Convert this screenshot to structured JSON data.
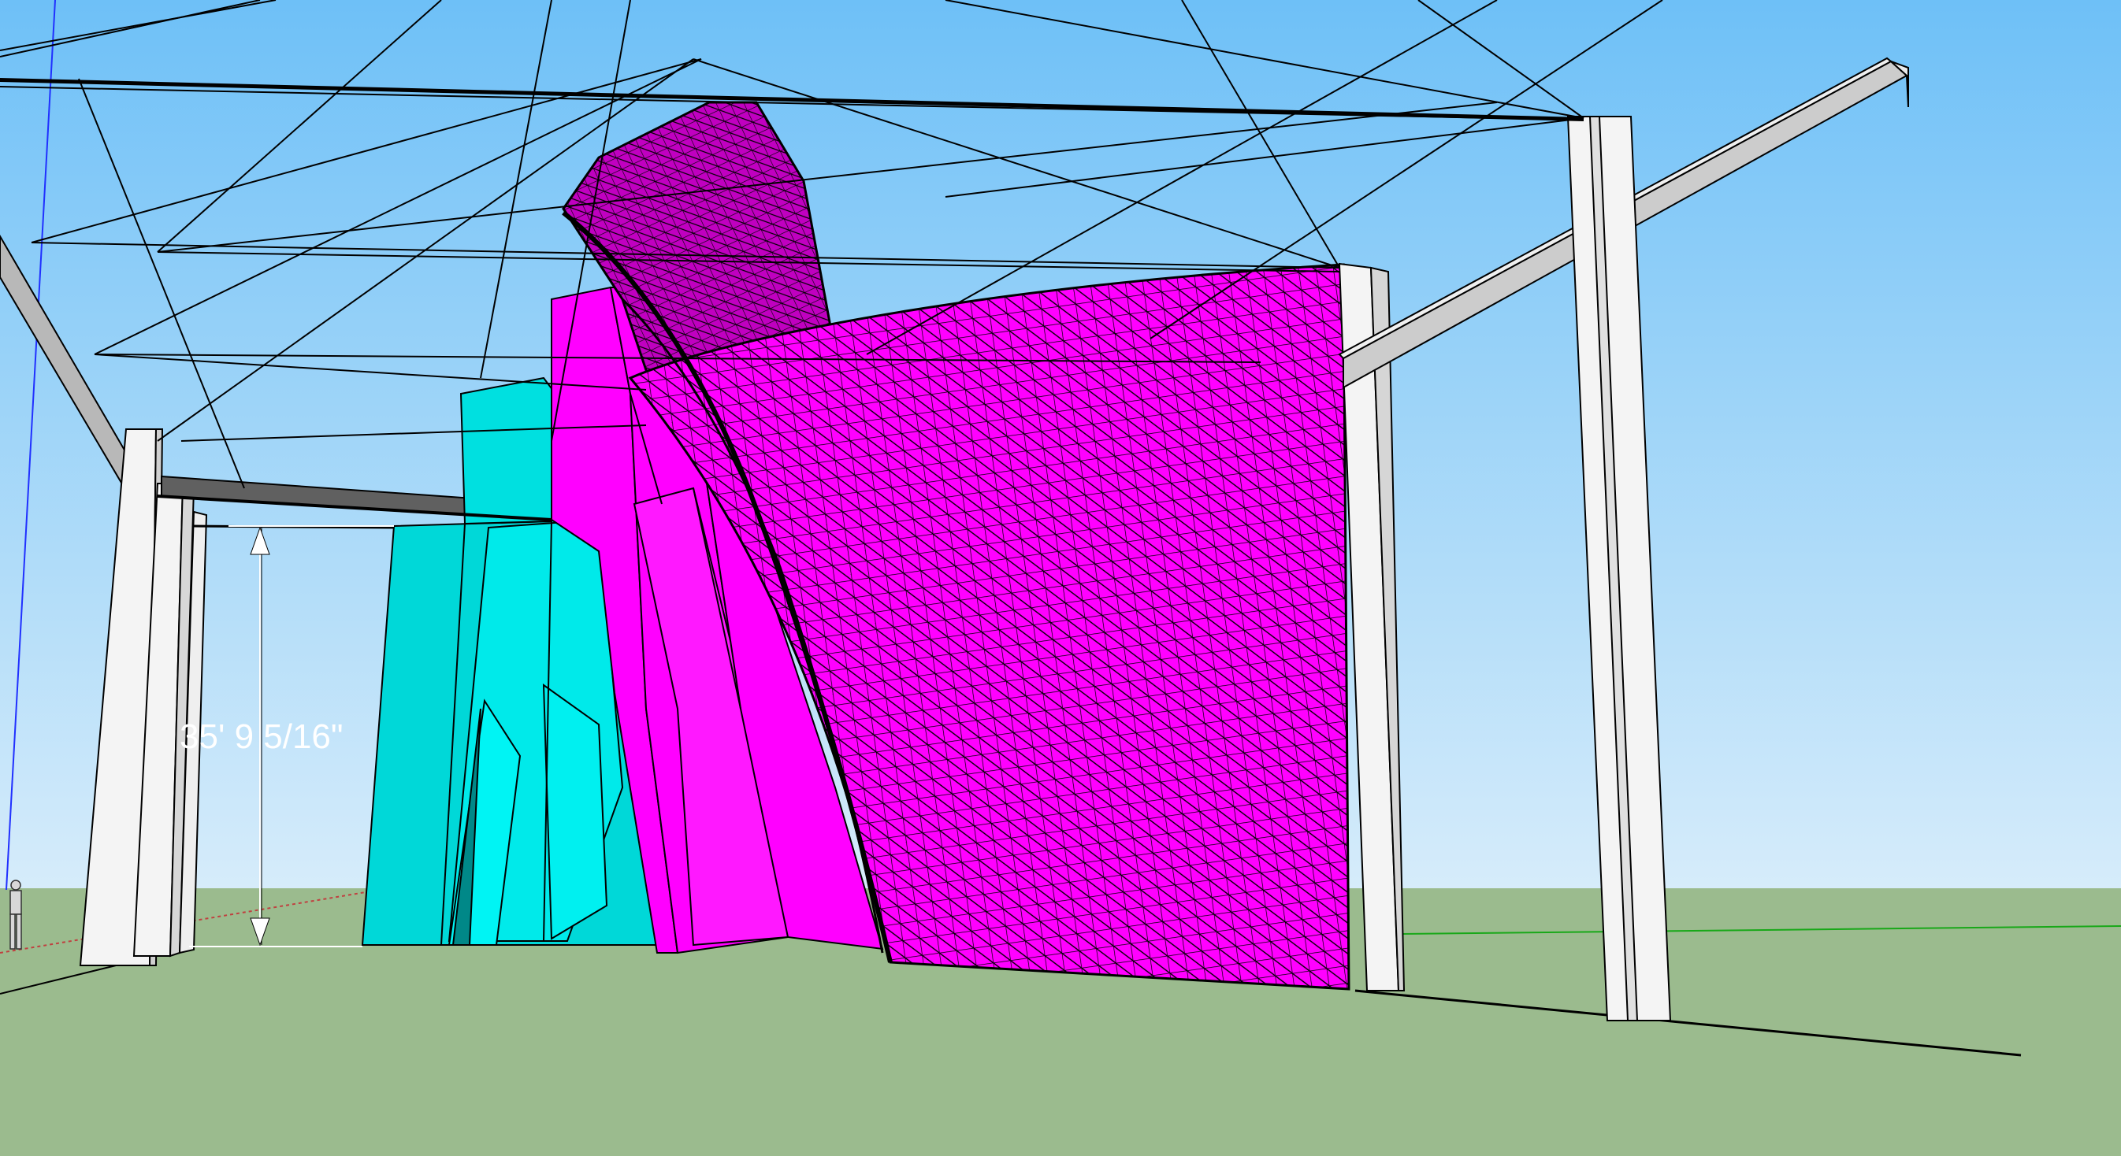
{
  "viewport": {
    "sky_top_color": "#6ec0f7",
    "sky_bottom_color": "#d6ecfa",
    "ground_color": "#9bbb8e"
  },
  "model": {
    "mesh_color": "#ff00ff",
    "inner_shell_color": "#00e5e5",
    "column_color": "#f4f4f4",
    "beam_color": "#c9c9c9",
    "edge_color": "#000000"
  },
  "dimension": {
    "label": "35' 9 5/16\""
  },
  "axes": {
    "red": "#c04040",
    "green": "#18a818",
    "blue": "#2030ff"
  }
}
